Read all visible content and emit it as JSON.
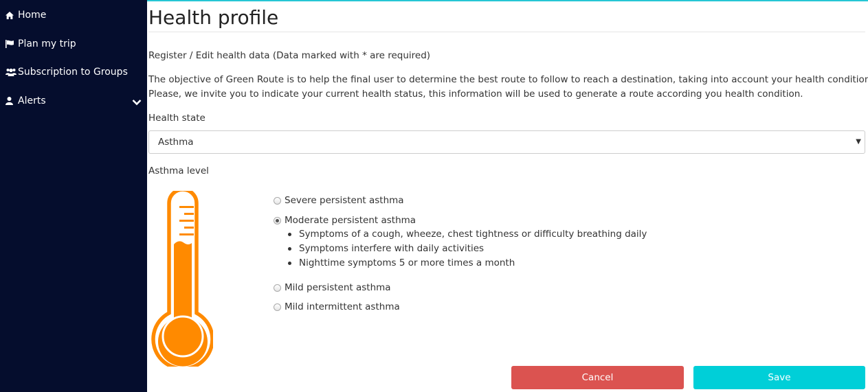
{
  "sidebar": {
    "items": [
      {
        "label": "Home",
        "icon": "home-icon"
      },
      {
        "label": "Plan my trip",
        "icon": "flag-icon"
      },
      {
        "label": "Subscription to Groups",
        "icon": "users-icon"
      },
      {
        "label": "Alerts",
        "icon": "user-icon"
      }
    ]
  },
  "page": {
    "title": "Health profile",
    "subtitle": "Register / Edit health data (Data marked with * are required)",
    "description_line1": "The objective of Green Route is to help the final user to determine the best route to follow to reach a destination, taking into account your health condition.",
    "description_line2": "Please, we invite you to indicate your current health status, this information will be used to generate a route according you health condition."
  },
  "form": {
    "health_state_label": "Health state",
    "health_state_value": "Asthma",
    "asthma_level_label": "Asthma level",
    "levels": [
      {
        "label": "Severe persistent asthma",
        "checked": false
      },
      {
        "label": "Moderate persistent asthma",
        "checked": true
      },
      {
        "label": "Mild persistent asthma",
        "checked": false
      },
      {
        "label": "Mild intermittent asthma",
        "checked": false
      }
    ],
    "moderate_symptoms": [
      "Symptoms of a cough, wheeze, chest tightness or difficulty breathing daily",
      "Symptoms interfere with daily activities",
      "Nighttime symptoms 5 or more times a month"
    ]
  },
  "actions": {
    "cancel_label": "Cancel",
    "save_label": "Save"
  },
  "colors": {
    "sidebar_bg": "#050d2d",
    "accent": "#00cfd8",
    "cancel": "#db5350",
    "thermometer": "#ff8a00"
  }
}
